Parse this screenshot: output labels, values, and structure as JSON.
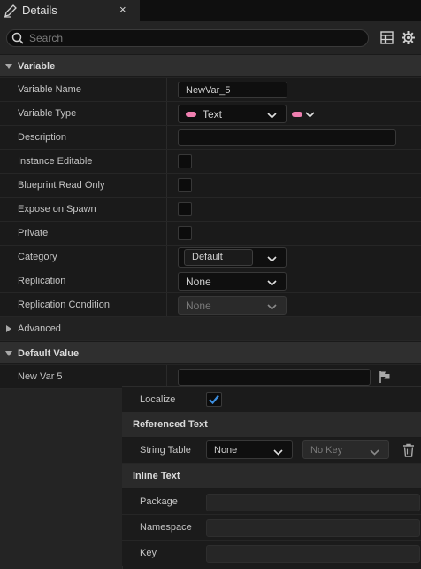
{
  "tab": {
    "title": "Details",
    "close": "×"
  },
  "search": {
    "placeholder": "Search"
  },
  "sections": {
    "variable": "Variable",
    "advanced": "Advanced",
    "default_value": "Default Value"
  },
  "rows": {
    "variable_name": {
      "label": "Variable Name",
      "value": "NewVar_5"
    },
    "variable_type": {
      "label": "Variable Type",
      "value": "Text"
    },
    "description": {
      "label": "Description",
      "value": ""
    },
    "instance_editable": {
      "label": "Instance Editable",
      "checked": false
    },
    "blueprint_read_only": {
      "label": "Blueprint Read Only",
      "checked": false
    },
    "expose_on_spawn": {
      "label": "Expose on Spawn",
      "checked": false
    },
    "private": {
      "label": "Private",
      "checked": false
    },
    "category": {
      "label": "Category",
      "value": "Default"
    },
    "replication": {
      "label": "Replication",
      "value": "None"
    },
    "replication_condition": {
      "label": "Replication Condition",
      "value": "None"
    },
    "new_var_5": {
      "label": "New Var 5",
      "value": ""
    }
  },
  "popup": {
    "localize": {
      "label": "Localize",
      "checked": true
    },
    "referenced_text": "Referenced Text",
    "string_table": {
      "label": "String Table",
      "table_value": "None",
      "key_value": "No Key"
    },
    "inline_text": "Inline Text",
    "package": {
      "label": "Package",
      "value": ""
    },
    "namespace": {
      "label": "Namespace",
      "value": ""
    },
    "key": {
      "label": "Key",
      "value": ""
    }
  },
  "colors": {
    "text_pin": "#ef7fb0",
    "check_blue": "#3d8fe0",
    "panel": "#242424",
    "row": "#1a1a1a"
  }
}
